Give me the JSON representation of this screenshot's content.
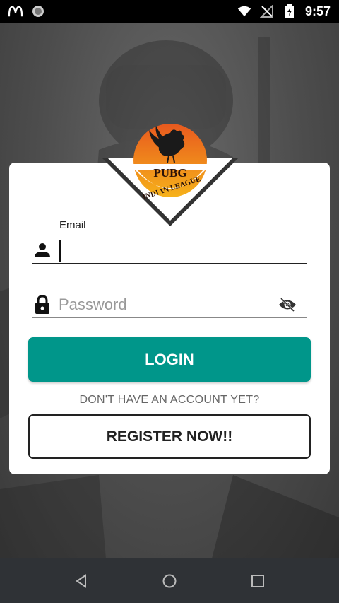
{
  "status_bar": {
    "time": "9:57",
    "icons": [
      "mcdonalds-notification-icon",
      "circle-notification-icon",
      "wifi-icon",
      "no-signal-icon",
      "battery-charging-icon"
    ]
  },
  "logo": {
    "line1": "PUBG",
    "line2": "INDIAN LEAGUE",
    "colors": {
      "sun_top": "#e8591e",
      "sun_bottom": "#f6b21a",
      "triangle": "#333333"
    }
  },
  "form": {
    "email_label": "Email",
    "email_value": "",
    "password_placeholder": "Password",
    "password_value": ""
  },
  "buttons": {
    "login": "LOGIN",
    "no_account": "DON'T HAVE AN ACCOUNT YET?",
    "register": "REGISTER NOW!!"
  },
  "colors": {
    "accent": "#00968a"
  }
}
